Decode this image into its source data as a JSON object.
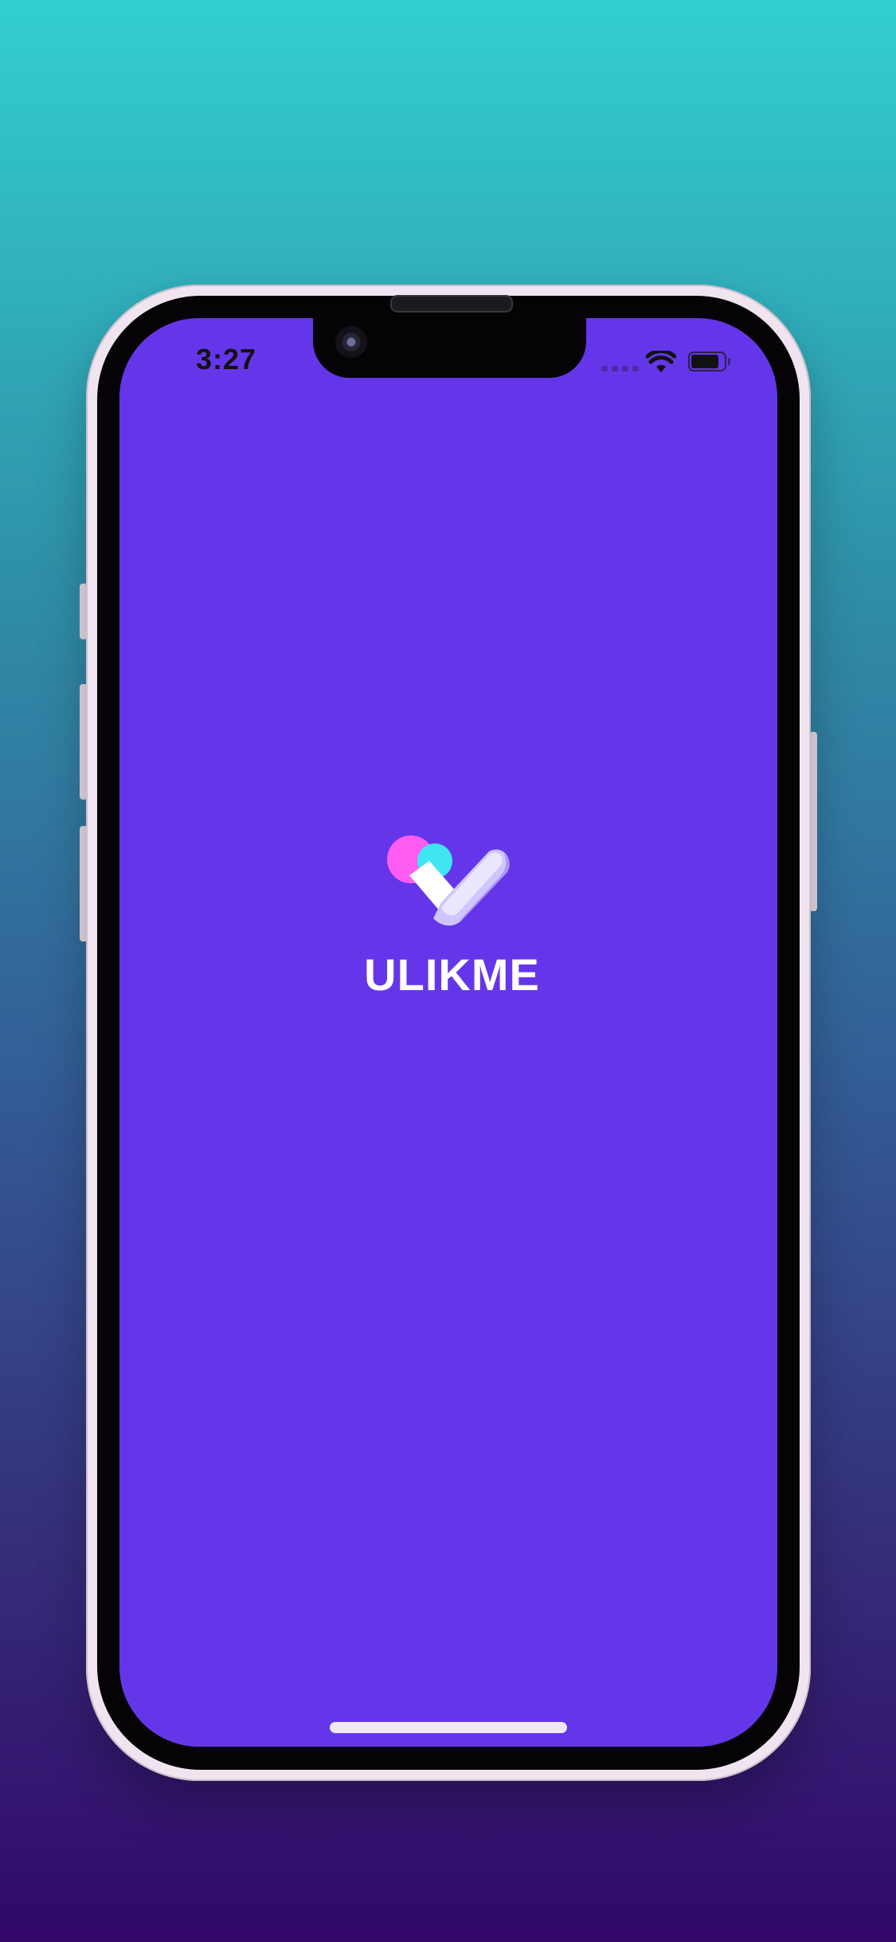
{
  "status_bar": {
    "time": "3:27",
    "signal_icon": "cellular-signal-icon",
    "wifi_icon": "wifi-icon",
    "battery_icon": "battery-icon"
  },
  "splash": {
    "logo_icon": "ulikme-heart-check-logo",
    "app_name": "ULIKME"
  },
  "colors": {
    "screen_background": "#6536e9",
    "backdrop_top": "#32cfd0",
    "backdrop_bottom": "#320869",
    "logo_pink": "#ff5cf3",
    "logo_cyan": "#3fe6f2",
    "logo_light": "#e7e2ff",
    "text": "#ffffff"
  }
}
